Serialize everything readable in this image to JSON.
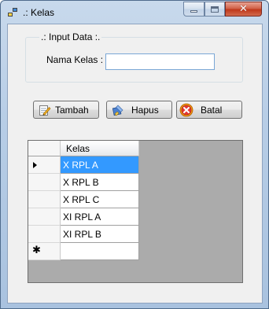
{
  "window": {
    "title": ".: Kelas",
    "close_glyph": "✕"
  },
  "form": {
    "group_label": ".: Input Data :.",
    "nama_kelas_label": "Nama Kelas :",
    "nama_kelas_value": ""
  },
  "buttons": {
    "tambah": {
      "label": "Tambah",
      "icon": "pencil-edit-icon"
    },
    "hapus": {
      "label": "Hapus",
      "icon": "broom-icon"
    },
    "batal": {
      "label": "Batal",
      "icon": "cancel-icon"
    }
  },
  "grid": {
    "columns": [
      "Kelas"
    ],
    "rows": [
      "X RPL A",
      "X RPL B",
      "X RPL C",
      "XI RPL A",
      "XI RPL B"
    ],
    "selected_row": 0,
    "new_row_marker": "✱"
  },
  "colors": {
    "selection": "#3399ff",
    "grid_background": "#ababab",
    "client_background": "#f0f0f0"
  }
}
